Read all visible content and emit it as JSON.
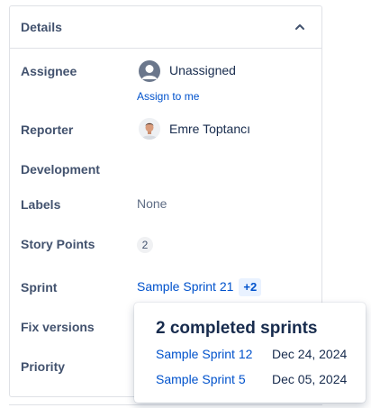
{
  "panel": {
    "title": "Details"
  },
  "fields": {
    "assignee": {
      "label": "Assignee",
      "value": "Unassigned",
      "action": "Assign to me"
    },
    "reporter": {
      "label": "Reporter",
      "value": "Emre Toptancı"
    },
    "development": {
      "label": "Development"
    },
    "labels": {
      "label": "Labels",
      "value": "None"
    },
    "story_points": {
      "label": "Story Points",
      "value": "2"
    },
    "sprint": {
      "label": "Sprint",
      "value": "Sample Sprint 21",
      "more": "+2"
    },
    "fix_versions": {
      "label": "Fix versions"
    },
    "priority": {
      "label": "Priority"
    }
  },
  "popup": {
    "title": "2 completed sprints",
    "items": [
      {
        "name": "Sample Sprint 12",
        "date": "Dec 24, 2024"
      },
      {
        "name": "Sample Sprint 5",
        "date": "Dec 05, 2024"
      }
    ]
  },
  "colors": {
    "link": "#0052cc",
    "label": "#42526e",
    "border": "#dfe1e6"
  },
  "icons": {
    "collapse": "chevron-up-icon",
    "unassigned": "user-avatar-icon"
  }
}
